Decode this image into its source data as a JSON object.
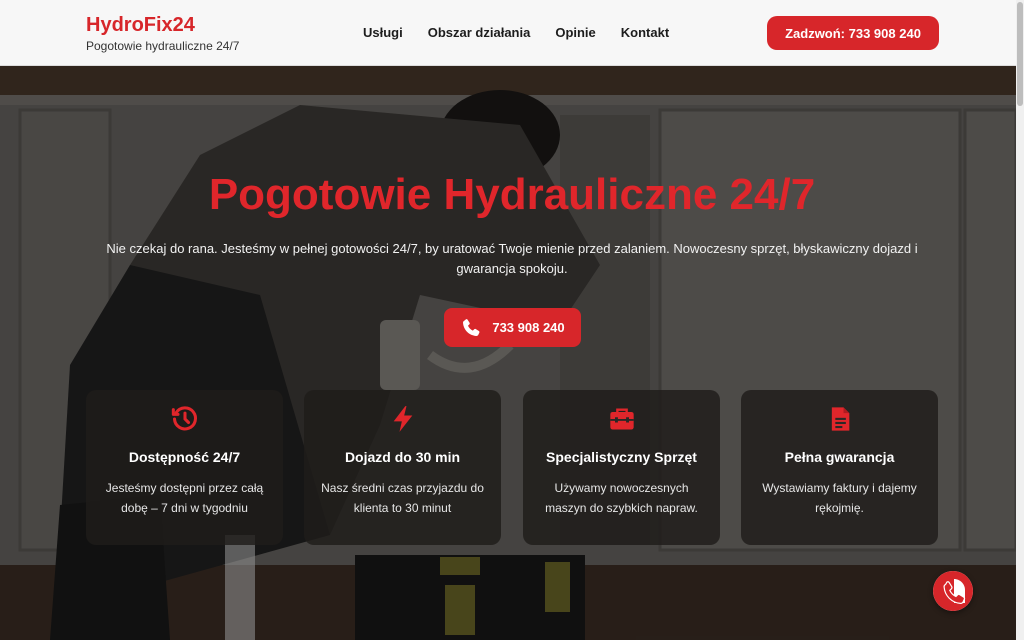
{
  "header": {
    "logo": "HydroFix24",
    "tagline": "Pogotowie hydrauliczne 24/7",
    "nav": [
      "Usługi",
      "Obszar działania",
      "Opinie",
      "Kontakt"
    ],
    "call_button": "Zadzwoń: 733 908 240"
  },
  "hero": {
    "title": "Pogotowie Hydrauliczne 24/7",
    "text": "Nie czekaj do rana. Jesteśmy w pełnej gotowości 24/7, by uratować Twoje mienie przed zalaniem. Nowoczesny sprzęt, błyskawiczny dojazd i gwarancja spokoju.",
    "phone_button": "733 908 240"
  },
  "features": [
    {
      "icon": "history-clock-icon",
      "title": "Dostępność 24/7",
      "text": "Jesteśmy dostępni przez całą dobę – 7 dni w tygodniu"
    },
    {
      "icon": "lightning-icon",
      "title": "Dojazd do 30 min",
      "text": "Nasz średni czas przyjazdu do klienta to 30 minut"
    },
    {
      "icon": "toolbox-icon",
      "title": "Specjalistyczny Sprzęt",
      "text": "Używamy nowoczesnych maszyn do szybkich napraw."
    },
    {
      "icon": "document-icon",
      "title": "Pełna gwarancja",
      "text": "Wystawiamy faktury i dajemy rękojmię."
    }
  ],
  "colors": {
    "accent": "#d7262a",
    "header_bg": "#f7f7f7",
    "card_bg": "#1e1c1a"
  }
}
